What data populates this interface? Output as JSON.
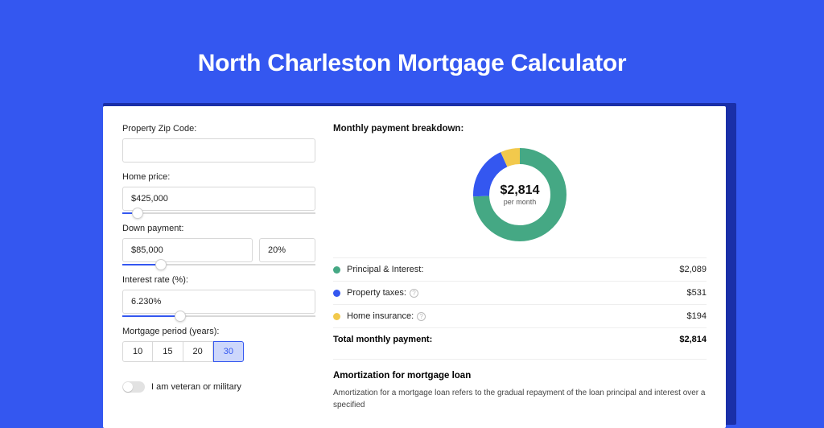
{
  "hero": {
    "title": "North Charleston Mortgage Calculator"
  },
  "form": {
    "zip": {
      "label": "Property Zip Code:",
      "value": ""
    },
    "price": {
      "label": "Home price:",
      "value": "$425,000",
      "slider_pct": 8
    },
    "down": {
      "label": "Down payment:",
      "value": "$85,000",
      "pct": "20%",
      "slider_pct": 20
    },
    "rate": {
      "label": "Interest rate (%):",
      "value": "6.230%",
      "slider_pct": 30
    },
    "period": {
      "label": "Mortgage period (years):",
      "options": [
        "10",
        "15",
        "20",
        "30"
      ],
      "active_index": 3
    },
    "veteran": {
      "label": "I am veteran or military",
      "on": false
    }
  },
  "breakdown": {
    "title": "Monthly payment breakdown:",
    "center_amount": "$2,814",
    "center_sub": "per month",
    "items": [
      {
        "label": "Principal & Interest:",
        "value": "$2,089",
        "color": "#45a884",
        "info": false
      },
      {
        "label": "Property taxes:",
        "value": "$531",
        "color": "#3457f0",
        "info": true
      },
      {
        "label": "Home insurance:",
        "value": "$194",
        "color": "#f2c94c",
        "info": true
      }
    ],
    "total_label": "Total monthly payment:",
    "total_value": "$2,814"
  },
  "chart_data": {
    "type": "pie",
    "title": "Monthly payment breakdown",
    "series": [
      {
        "name": "Principal & Interest",
        "value": 2089,
        "color": "#45a884"
      },
      {
        "name": "Property taxes",
        "value": 531,
        "color": "#3457f0"
      },
      {
        "name": "Home insurance",
        "value": 194,
        "color": "#f2c94c"
      }
    ],
    "total": 2814,
    "center_label": "$2,814 per month"
  },
  "amortization": {
    "title": "Amortization for mortgage loan",
    "text": "Amortization for a mortgage loan refers to the gradual repayment of the loan principal and interest over a specified"
  }
}
